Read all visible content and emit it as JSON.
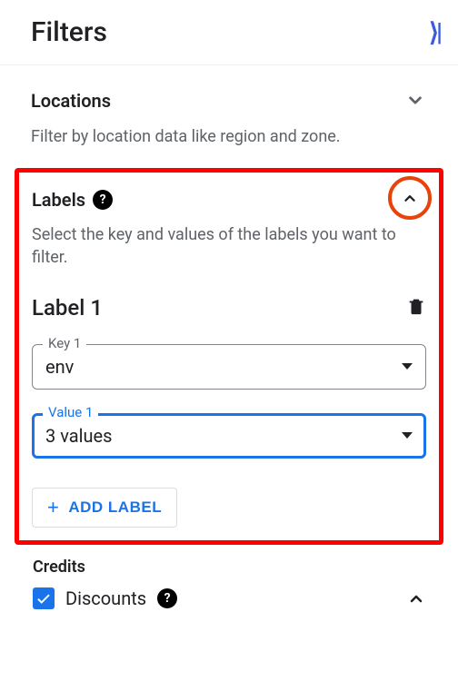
{
  "header": {
    "title": "Filters"
  },
  "locations": {
    "title": "Locations",
    "description": "Filter by location data like region and zone."
  },
  "labels": {
    "title": "Labels",
    "description": "Select the key and values of the labels you want to filter.",
    "item_title": "Label 1",
    "key_field": {
      "label": "Key 1",
      "value": "env"
    },
    "value_field": {
      "label": "Value 1",
      "value": "3 values"
    },
    "add_button": "ADD LABEL"
  },
  "credits": {
    "title": "Credits",
    "discount_label": "Discounts"
  }
}
